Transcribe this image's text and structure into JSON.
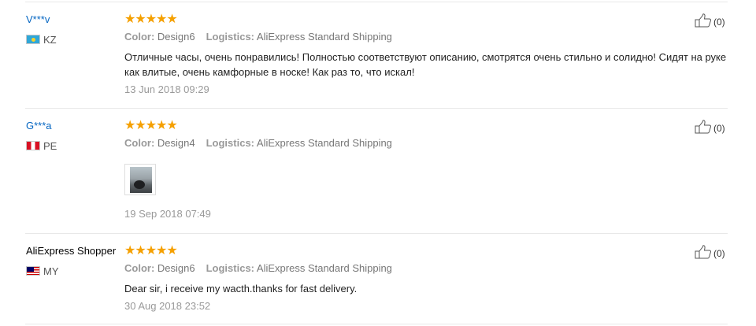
{
  "reviews": [
    {
      "user": "V***v",
      "country": "KZ",
      "stars": "★★★★★",
      "color_label": "Color:",
      "color_value": "Design6",
      "logistics_label": "Logistics:",
      "logistics_value": "AliExpress Standard Shipping",
      "text": "Отличные часы, очень понравились! Полностью соответствуют описанию, смотрятся очень стильно и солидно! Сидят на руке как влитые, очень камфорные в носке! Как раз то, что искал!",
      "date": "13 Jun 2018 09:29",
      "helpful_count": "(0)"
    },
    {
      "user": "G***a",
      "country": "PE",
      "stars": "★★★★★",
      "color_label": "Color:",
      "color_value": "Design4",
      "logistics_label": "Logistics:",
      "logistics_value": "AliExpress Standard Shipping",
      "date": "19 Sep 2018 07:49",
      "helpful_count": "(0)"
    },
    {
      "user": "AliExpress Shopper",
      "country": "MY",
      "stars": "★★★★★",
      "color_label": "Color:",
      "color_value": "Design6",
      "logistics_label": "Logistics:",
      "logistics_value": "AliExpress Standard Shipping",
      "text": "Dear sir, i receive my wacth.thanks for fast delivery.",
      "date": "30 Aug 2018 23:52",
      "helpful_count": "(0)"
    }
  ],
  "colors": {
    "link": "#0566c2",
    "star": "#f5a000",
    "rule": "#e8e8e8"
  },
  "icons": {
    "helpful": "thumbs-up-icon",
    "rating": "star-icon"
  }
}
